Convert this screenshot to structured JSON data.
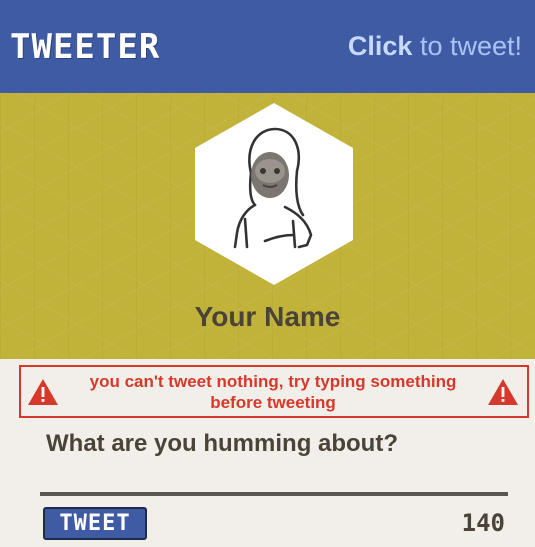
{
  "header": {
    "logo": "TWEETER",
    "cta_strong": "Click",
    "cta_rest": " to tweet!"
  },
  "profile": {
    "name": "Your Name"
  },
  "error": {
    "message": "you can't tweet nothing, try typing something before tweeting"
  },
  "composer": {
    "placeholder": "What are you humming about?",
    "value": ""
  },
  "footer": {
    "tweet_label": "TWEET",
    "char_count": "140"
  },
  "colors": {
    "brand_blue": "#3f5ba3",
    "profile_bg": "#c1b23a",
    "error_red": "#d6392b",
    "page_bg": "#f2efea",
    "text_dark": "#4a4438"
  }
}
